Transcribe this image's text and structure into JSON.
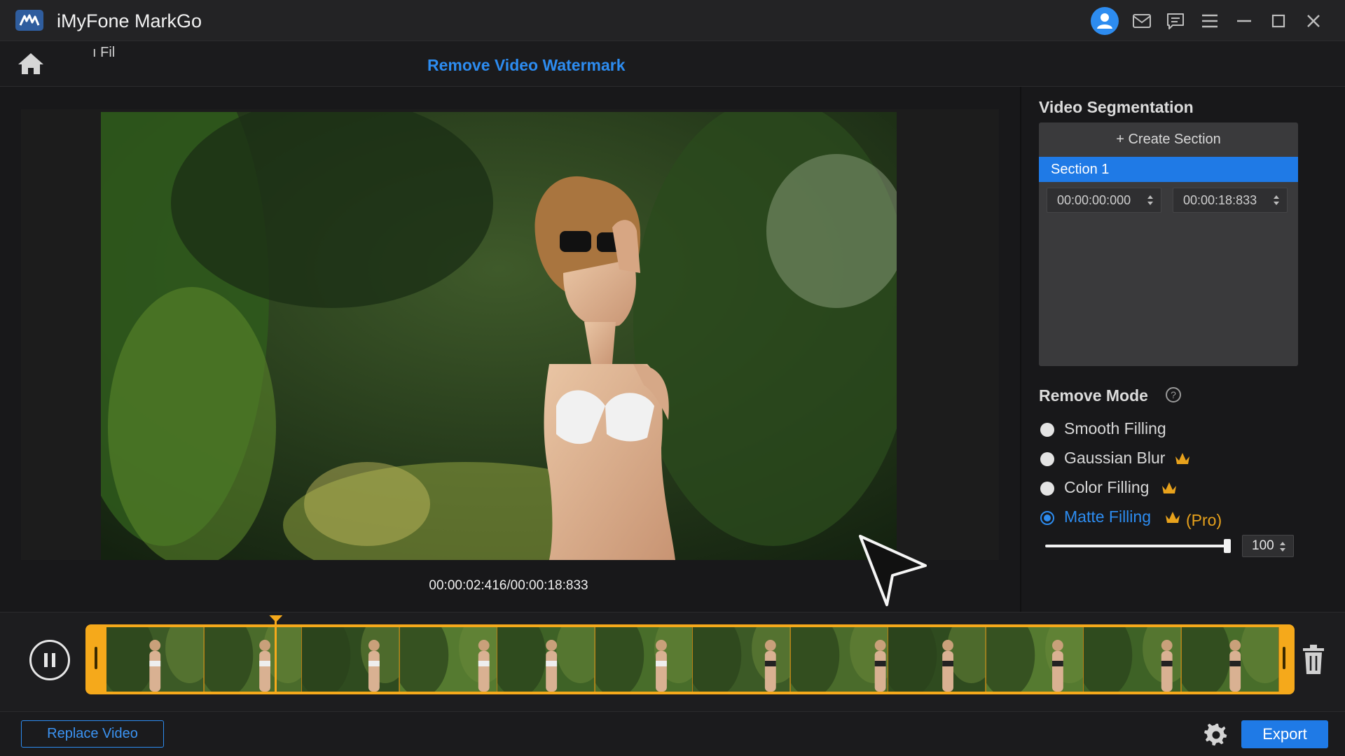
{
  "window": {
    "app_title": "iMyFone MarkGo",
    "controls": [
      "user-icon",
      "mail-icon",
      "chat-icon",
      "menu-icon",
      "minimize-icon",
      "maximize-icon",
      "close-icon"
    ]
  },
  "nav": {
    "breadcrumb_fragment": "ı Fil",
    "page_title": "Remove Video Watermark"
  },
  "player": {
    "current_time": "00:00:02:416",
    "total_time": "00:00:18:833",
    "timecode": "00:00:02:416/00:00:18:833",
    "playhead_fraction": 0.146
  },
  "segmentation": {
    "title": "Video Segmentation",
    "create_label": "+ Create Section",
    "sections": [
      {
        "label": "Section 1",
        "start": "00:00:00:000",
        "end": "00:00:18:833",
        "selected": true
      }
    ]
  },
  "remove_mode": {
    "title": "Remove Mode",
    "help_glyph": "?",
    "options": [
      {
        "label": "Smooth Filling",
        "premium": false,
        "selected": false
      },
      {
        "label": "Gaussian Blur",
        "premium": true,
        "selected": false
      },
      {
        "label": "Color Filling",
        "premium": true,
        "selected": false
      },
      {
        "label": "Matte Filling",
        "premium": true,
        "selected": true,
        "tag": "(Pro)"
      }
    ],
    "strength_value": "100",
    "strength_fraction": 1.0
  },
  "timeline": {
    "frame_count": 12
  },
  "footer": {
    "replace_label": "Replace Video",
    "export_label": "Export"
  },
  "colors": {
    "accent": "#2d8cf0",
    "timeline_border": "#f5a91b",
    "premium": "#e8a21c"
  }
}
